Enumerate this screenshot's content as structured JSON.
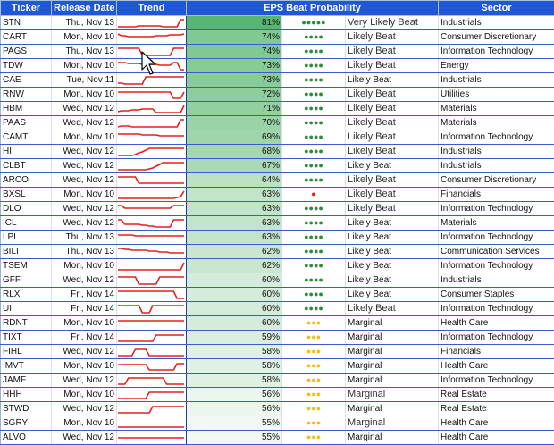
{
  "headers": {
    "ticker": "Ticker",
    "release_date": "Release Date",
    "trend": "Trend",
    "eps_beat_probability": "EPS Beat Probability",
    "sector": "Sector"
  },
  "colors": {
    "header_bg": "#1f57d6",
    "trend_line": "#e0201b",
    "dot_green": "#2e8b3a",
    "dot_yellow": "#f0c020",
    "dot_red": "#e0201b",
    "heat_high": "#58b76e",
    "heat_low": "#f1f8f2"
  },
  "rows": [
    {
      "ticker": "STN",
      "date": "Thu, Nov 13",
      "pct": "81%",
      "p": 81,
      "dots": "●●●●●",
      "dot_color": "green",
      "label": "Very Likely Beat",
      "large": true,
      "sector": "Industrials",
      "trend": [
        12,
        12,
        12,
        12,
        12,
        12,
        11,
        11,
        11,
        11,
        11,
        11,
        11,
        12,
        12,
        12,
        12,
        12,
        4,
        4
      ]
    },
    {
      "ticker": "CART",
      "date": "Mon, Nov 10",
      "pct": "74%",
      "p": 74,
      "dots": "●●●●",
      "dot_color": "green",
      "label": "Likely Beat",
      "large": true,
      "sector": "Consumer Discretionary",
      "trend": [
        4,
        6,
        6,
        7,
        7,
        7,
        7,
        7,
        7,
        7,
        7,
        6,
        6,
        6,
        6,
        5,
        5,
        5,
        5,
        4
      ]
    },
    {
      "ticker": "PAGS",
      "date": "Thu, Nov 13",
      "pct": "74%",
      "p": 74,
      "dots": "●●●●",
      "dot_color": "green",
      "label": "Likely Beat",
      "large": true,
      "sector": "Information Technology",
      "trend": [
        4,
        4,
        4,
        4,
        4,
        4,
        4,
        12,
        12,
        12,
        12,
        12,
        12,
        12,
        12,
        12,
        4,
        4,
        4,
        4
      ]
    },
    {
      "ticker": "TDW",
      "date": "Mon, Nov 10",
      "pct": "73%",
      "p": 73,
      "dots": "●●●●",
      "dot_color": "green",
      "label": "Likely Beat",
      "large": true,
      "sector": "Energy",
      "trend": [
        4,
        4,
        4,
        5,
        5,
        5,
        5,
        6,
        6,
        6,
        6,
        6,
        7,
        7,
        7,
        7,
        4,
        4,
        12,
        12
      ]
    },
    {
      "ticker": "CAE",
      "date": "Tue, Nov 11",
      "pct": "73%",
      "p": 73,
      "dots": "●●●●",
      "dot_color": "green",
      "label": "Likely Beat",
      "large": false,
      "sector": "Industrials",
      "trend": [
        11,
        11,
        12,
        12,
        12,
        12,
        12,
        12,
        4,
        4,
        4,
        4,
        4,
        4,
        4,
        4,
        4,
        4,
        4,
        4
      ]
    },
    {
      "ticker": "RNW",
      "date": "Mon, Nov 10",
      "pct": "72%",
      "p": 72,
      "dots": "●●●●",
      "dot_color": "green",
      "label": "Likely Beat",
      "large": true,
      "sector": "Utilities",
      "trend": [
        5,
        5,
        5,
        5,
        5,
        5,
        5,
        5,
        5,
        5,
        5,
        5,
        5,
        5,
        5,
        5,
        12,
        12,
        12,
        5
      ]
    },
    {
      "ticker": "HBM",
      "date": "Wed, Nov 12",
      "pct": "71%",
      "p": 71,
      "dots": "●●●●",
      "dot_color": "green",
      "label": "Likely Beat",
      "large": true,
      "sector": "Materials",
      "trend": [
        11,
        10,
        10,
        10,
        9,
        9,
        9,
        8,
        8,
        8,
        8,
        12,
        12,
        12,
        12,
        12,
        12,
        12,
        12,
        4
      ]
    },
    {
      "ticker": "PAAS",
      "date": "Wed, Nov 12",
      "pct": "70%",
      "p": 70,
      "dots": "●●●●",
      "dot_color": "green",
      "label": "Likely Beat",
      "large": true,
      "sector": "Materials",
      "trend": [
        12,
        11,
        11,
        11,
        12,
        12,
        12,
        12,
        12,
        12,
        12,
        12,
        12,
        12,
        12,
        12,
        12,
        12,
        4,
        4
      ]
    },
    {
      "ticker": "CAMT",
      "date": "Mon, Nov 10",
      "pct": "69%",
      "p": 69,
      "dots": "●●●●",
      "dot_color": "green",
      "label": "Likely Beat",
      "large": true,
      "sector": "Information Technology",
      "trend": [
        4,
        4,
        4,
        4,
        4,
        4,
        4,
        5,
        5,
        5,
        5,
        5,
        6,
        6,
        6,
        6,
        6,
        6,
        6,
        6
      ]
    },
    {
      "ticker": "HI",
      "date": "Wed, Nov 12",
      "pct": "68%",
      "p": 68,
      "dots": "●●●●",
      "dot_color": "green",
      "label": "Likely Beat",
      "large": true,
      "sector": "Industrials",
      "trend": [
        12,
        12,
        12,
        12,
        12,
        11,
        9,
        8,
        6,
        4,
        4,
        4,
        4,
        4,
        4,
        4,
        4,
        4,
        4,
        4
      ]
    },
    {
      "ticker": "CLBT",
      "date": "Wed, Nov 12",
      "pct": "67%",
      "p": 67,
      "dots": "●●●●",
      "dot_color": "green",
      "label": "Likely Beat",
      "large": false,
      "sector": "Industrials",
      "trend": [
        12,
        12,
        12,
        12,
        12,
        12,
        12,
        12,
        12,
        11,
        10,
        8,
        6,
        4,
        4,
        4,
        4,
        4,
        4,
        4
      ]
    },
    {
      "ticker": "ARCO",
      "date": "Wed, Nov 12",
      "pct": "64%",
      "p": 64,
      "dots": "●●●●",
      "dot_color": "green",
      "label": "Likely Beat",
      "large": true,
      "sector": "Consumer Discretionary",
      "trend": [
        4,
        4,
        4,
        4,
        4,
        4,
        11,
        11,
        11,
        11,
        11,
        11,
        11,
        11,
        11,
        11,
        11,
        11,
        11,
        11
      ]
    },
    {
      "ticker": "BXSL",
      "date": "Mon, Nov 10",
      "pct": "63%",
      "p": 63,
      "dots": "●",
      "dot_color": "red",
      "label": "Likely Beat",
      "large": true,
      "sector": "Financials",
      "trend": [
        12,
        12,
        12,
        12,
        12,
        12,
        12,
        12,
        12,
        12,
        12,
        12,
        12,
        12,
        12,
        12,
        12,
        11,
        10,
        4
      ]
    },
    {
      "ticker": "DLO",
      "date": "Wed, Nov 12",
      "pct": "63%",
      "p": 63,
      "dots": "●●●●",
      "dot_color": "green",
      "label": "Likely Beat",
      "large": true,
      "sector": "Information Technology",
      "trend": [
        4,
        4,
        7,
        7,
        7,
        7,
        7,
        7,
        7,
        7,
        7,
        7,
        7,
        7,
        7,
        7,
        4,
        4,
        4,
        4
      ]
    },
    {
      "ticker": "ICL",
      "date": "Wed, Nov 12",
      "pct": "63%",
      "p": 63,
      "dots": "●●●●",
      "dot_color": "green",
      "label": "Likely Beat",
      "large": false,
      "sector": "Materials",
      "trend": [
        4,
        4,
        9,
        9,
        9,
        9,
        9,
        10,
        10,
        11,
        11,
        12,
        12,
        12,
        12,
        12,
        4,
        4,
        4,
        4
      ]
    },
    {
      "ticker": "LPL",
      "date": "Thu, Nov 13",
      "pct": "63%",
      "p": 63,
      "dots": "●●●●",
      "dot_color": "green",
      "label": "Likely Beat",
      "large": false,
      "sector": "Information Technology",
      "trend": [
        5,
        5,
        5,
        5,
        5,
        6,
        6,
        6,
        6,
        6,
        6,
        6,
        6,
        6,
        6,
        6,
        6,
        6,
        6,
        6
      ]
    },
    {
      "ticker": "BILI",
      "date": "Thu, Nov 13",
      "pct": "62%",
      "p": 62,
      "dots": "●●●●",
      "dot_color": "green",
      "label": "Likely Beat",
      "large": false,
      "sector": "Communication Services",
      "trend": [
        4,
        4,
        5,
        5,
        6,
        6,
        6,
        6,
        6,
        7,
        7,
        7,
        8,
        8,
        8,
        9,
        9,
        9,
        9,
        9
      ]
    },
    {
      "ticker": "TSEM",
      "date": "Mon, Nov 10",
      "pct": "62%",
      "p": 62,
      "dots": "●●●●",
      "dot_color": "green",
      "label": "Likely Beat",
      "large": false,
      "sector": "Information Technology",
      "trend": [
        12,
        12,
        12,
        12,
        12,
        12,
        12,
        12,
        12,
        12,
        12,
        12,
        12,
        12,
        12,
        12,
        12,
        12,
        12,
        4
      ]
    },
    {
      "ticker": "GFF",
      "date": "Wed, Nov 12",
      "pct": "60%",
      "p": 60,
      "dots": "●●●●",
      "dot_color": "green",
      "label": "Likely Beat",
      "large": false,
      "sector": "Industrials",
      "trend": [
        4,
        4,
        4,
        4,
        4,
        4,
        12,
        12,
        12,
        12,
        12,
        12,
        4,
        4,
        4,
        4,
        4,
        4,
        4,
        4
      ]
    },
    {
      "ticker": "RLX",
      "date": "Fri, Nov 14",
      "pct": "60%",
      "p": 60,
      "dots": "●●●●",
      "dot_color": "green",
      "label": "Likely Beat",
      "large": false,
      "sector": "Consumer Staples",
      "trend": [
        4,
        4,
        4,
        4,
        4,
        4,
        4,
        4,
        4,
        4,
        4,
        4,
        4,
        4,
        4,
        4,
        4,
        12,
        12,
        12
      ]
    },
    {
      "ticker": "UI",
      "date": "Fri, Nov 14",
      "pct": "60%",
      "p": 60,
      "dots": "●●●●",
      "dot_color": "green",
      "label": "Likely Beat",
      "large": true,
      "sector": "Information Technology",
      "trend": [
        4,
        4,
        4,
        4,
        4,
        4,
        4,
        12,
        12,
        12,
        4,
        4,
        4,
        4,
        4,
        4,
        4,
        4,
        4,
        4
      ]
    },
    {
      "ticker": "RDNT",
      "date": "Mon, Nov 10",
      "pct": "60%",
      "p": 60,
      "dots": "●●●",
      "dot_color": "yellow",
      "label": "Marginal",
      "large": false,
      "sector": "Health Care",
      "trend": [
        5,
        5,
        5,
        5,
        5,
        5,
        5,
        5,
        5,
        5,
        5,
        5,
        5,
        5,
        5,
        5,
        5,
        5,
        5,
        5
      ]
    },
    {
      "ticker": "TIXT",
      "date": "Fri, Nov 14",
      "pct": "59%",
      "p": 59,
      "dots": "●●●",
      "dot_color": "yellow",
      "label": "Marginal",
      "large": false,
      "sector": "Information Technology",
      "trend": [
        12,
        12,
        12,
        12,
        12,
        12,
        12,
        12,
        12,
        12,
        12,
        5,
        5,
        5,
        5,
        5,
        5,
        5,
        5,
        5
      ]
    },
    {
      "ticker": "FIHL",
      "date": "Wed, Nov 12",
      "pct": "58%",
      "p": 58,
      "dots": "●●●",
      "dot_color": "yellow",
      "label": "Marginal",
      "large": false,
      "sector": "Financials",
      "trend": [
        12,
        12,
        12,
        12,
        12,
        5,
        5,
        5,
        5,
        12,
        12,
        12,
        12,
        12,
        12,
        12,
        12,
        12,
        12,
        12
      ]
    },
    {
      "ticker": "IMVT",
      "date": "Mon, Nov 10",
      "pct": "58%",
      "p": 58,
      "dots": "●●●",
      "dot_color": "yellow",
      "label": "Marginal",
      "large": false,
      "sector": "Health Care",
      "trend": [
        6,
        6,
        6,
        6,
        6,
        6,
        6,
        6,
        6,
        12,
        12,
        12,
        12,
        12,
        12,
        12,
        12,
        5,
        5,
        5
      ]
    },
    {
      "ticker": "JAMF",
      "date": "Wed, Nov 12",
      "pct": "58%",
      "p": 58,
      "dots": "●●●",
      "dot_color": "yellow",
      "label": "Marginal",
      "large": false,
      "sector": "Information Technology",
      "trend": [
        12,
        12,
        12,
        5,
        5,
        5,
        5,
        5,
        5,
        5,
        5,
        5,
        5,
        5,
        12,
        12,
        12,
        12,
        12,
        12
      ]
    },
    {
      "ticker": "HHH",
      "date": "Mon, Nov 10",
      "pct": "56%",
      "p": 56,
      "dots": "●●●",
      "dot_color": "yellow",
      "label": "Marginal",
      "large": true,
      "sector": "Real Estate",
      "trend": [
        12,
        12,
        12,
        12,
        12,
        12,
        12,
        12,
        12,
        5,
        5,
        5,
        5,
        5,
        5,
        5,
        5,
        5,
        5,
        5
      ]
    },
    {
      "ticker": "STWD",
      "date": "Wed, Nov 12",
      "pct": "56%",
      "p": 56,
      "dots": "●●●",
      "dot_color": "yellow",
      "label": "Marginal",
      "large": false,
      "sector": "Real Estate",
      "trend": [
        12,
        12,
        12,
        12,
        12,
        12,
        12,
        12,
        12,
        12,
        5,
        5,
        5,
        5,
        5,
        5,
        5,
        5,
        5,
        5
      ]
    },
    {
      "ticker": "SGRY",
      "date": "Mon, Nov 10",
      "pct": "55%",
      "p": 55,
      "dots": "●●●",
      "dot_color": "yellow",
      "label": "Marginal",
      "large": true,
      "sector": "Health Care",
      "trend": [
        12,
        12,
        12,
        12,
        12,
        12,
        12,
        12,
        12,
        12,
        12,
        12,
        12,
        12,
        12,
        12,
        12,
        12,
        12,
        12
      ]
    },
    {
      "ticker": "ALVO",
      "date": "Wed, Nov 12",
      "pct": "55%",
      "p": 55,
      "dots": "●●●",
      "dot_color": "yellow",
      "label": "Marginal",
      "large": false,
      "sector": "Health Care",
      "trend": [
        8,
        8,
        8,
        8,
        8,
        8,
        8,
        8,
        8,
        8,
        8,
        8,
        8,
        8,
        8,
        8,
        8,
        8,
        8,
        8
      ]
    }
  ]
}
